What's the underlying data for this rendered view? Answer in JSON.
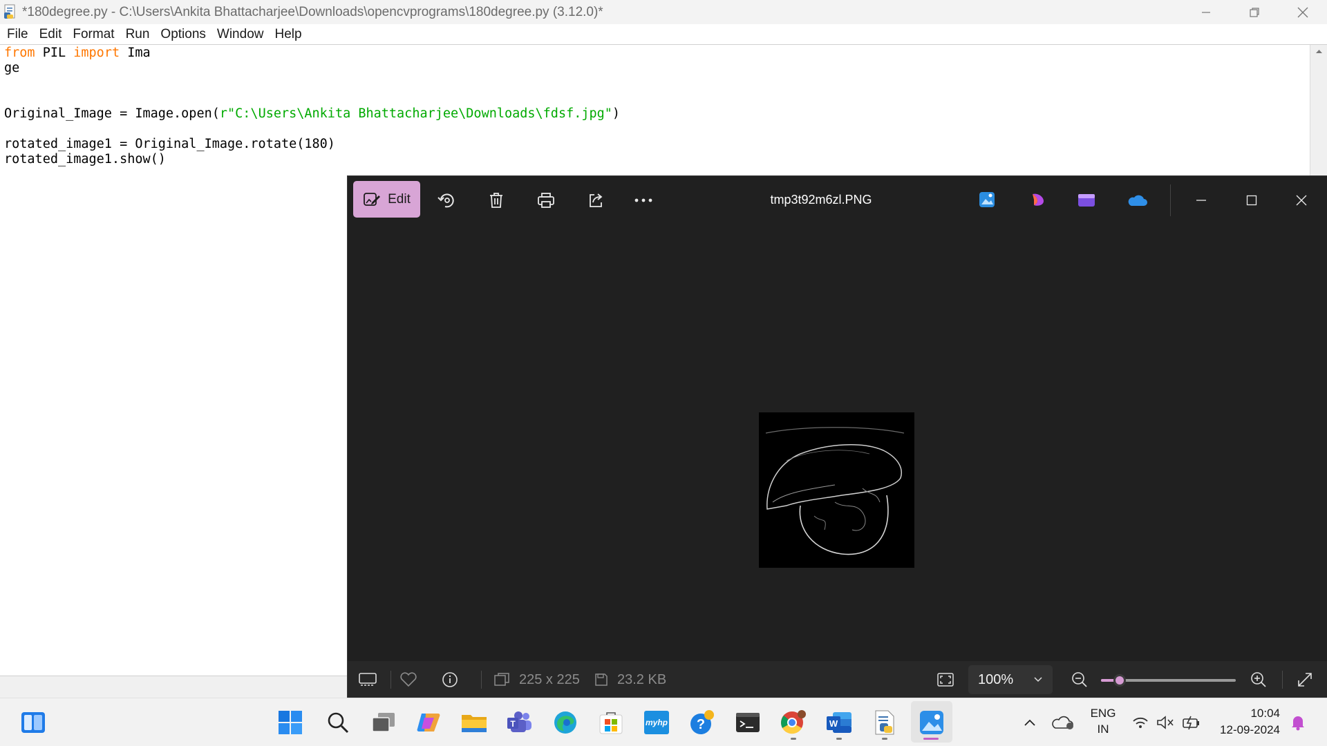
{
  "idle": {
    "title": "*180degree.py - C:\\Users\\Ankita Bhattacharjee\\Downloads\\opencvprograms\\180degree.py (3.12.0)*",
    "menu": [
      "File",
      "Edit",
      "Format",
      "Run",
      "Options",
      "Window",
      "Help"
    ],
    "code": {
      "line1_kw1": "from",
      "line1_mid": " PIL ",
      "line1_kw2": "import",
      "line1_rest": " Ima",
      "line2": "ge",
      "line5_pre": "Original_Image = Image.open(",
      "line5_str": "r\"C:\\Users\\Ankita Bhattacharjee\\Downloads\\fdsf.jpg\"",
      "line5_post": ")",
      "line7": "rotated_image1 = Original_Image.rotate(180)",
      "line8": "rotated_image1.show()"
    }
  },
  "photos": {
    "edit_label": "Edit",
    "filename": "tmp3t92m6zl.PNG",
    "dimensions": "225 x 225",
    "file_size": "23.2 KB",
    "zoom_label": "100%",
    "zoom_fraction": 0.14,
    "toolbar_icons": [
      "rotate-icon",
      "delete-icon",
      "print-icon",
      "share-icon",
      "more-icon"
    ],
    "app_icons": [
      "photos-app-icon",
      "copilot-app-icon",
      "clipchamp-app-icon",
      "onedrive-app-icon"
    ],
    "accent": "#d8a5d6"
  },
  "taskbar": {
    "language_top": "ENG",
    "language_bottom": "IN",
    "time": "10:04",
    "date": "12-09-2024",
    "apps": [
      "start-icon",
      "search-icon",
      "task-view-icon",
      "copilot-icon",
      "file-explorer-icon",
      "teams-icon",
      "edge-icon",
      "store-icon",
      "myhp-icon",
      "help-icon",
      "terminal-icon",
      "chrome-icon",
      "word-icon",
      "python-idle-icon",
      "photos-icon"
    ],
    "myhp_label": "myhp"
  }
}
